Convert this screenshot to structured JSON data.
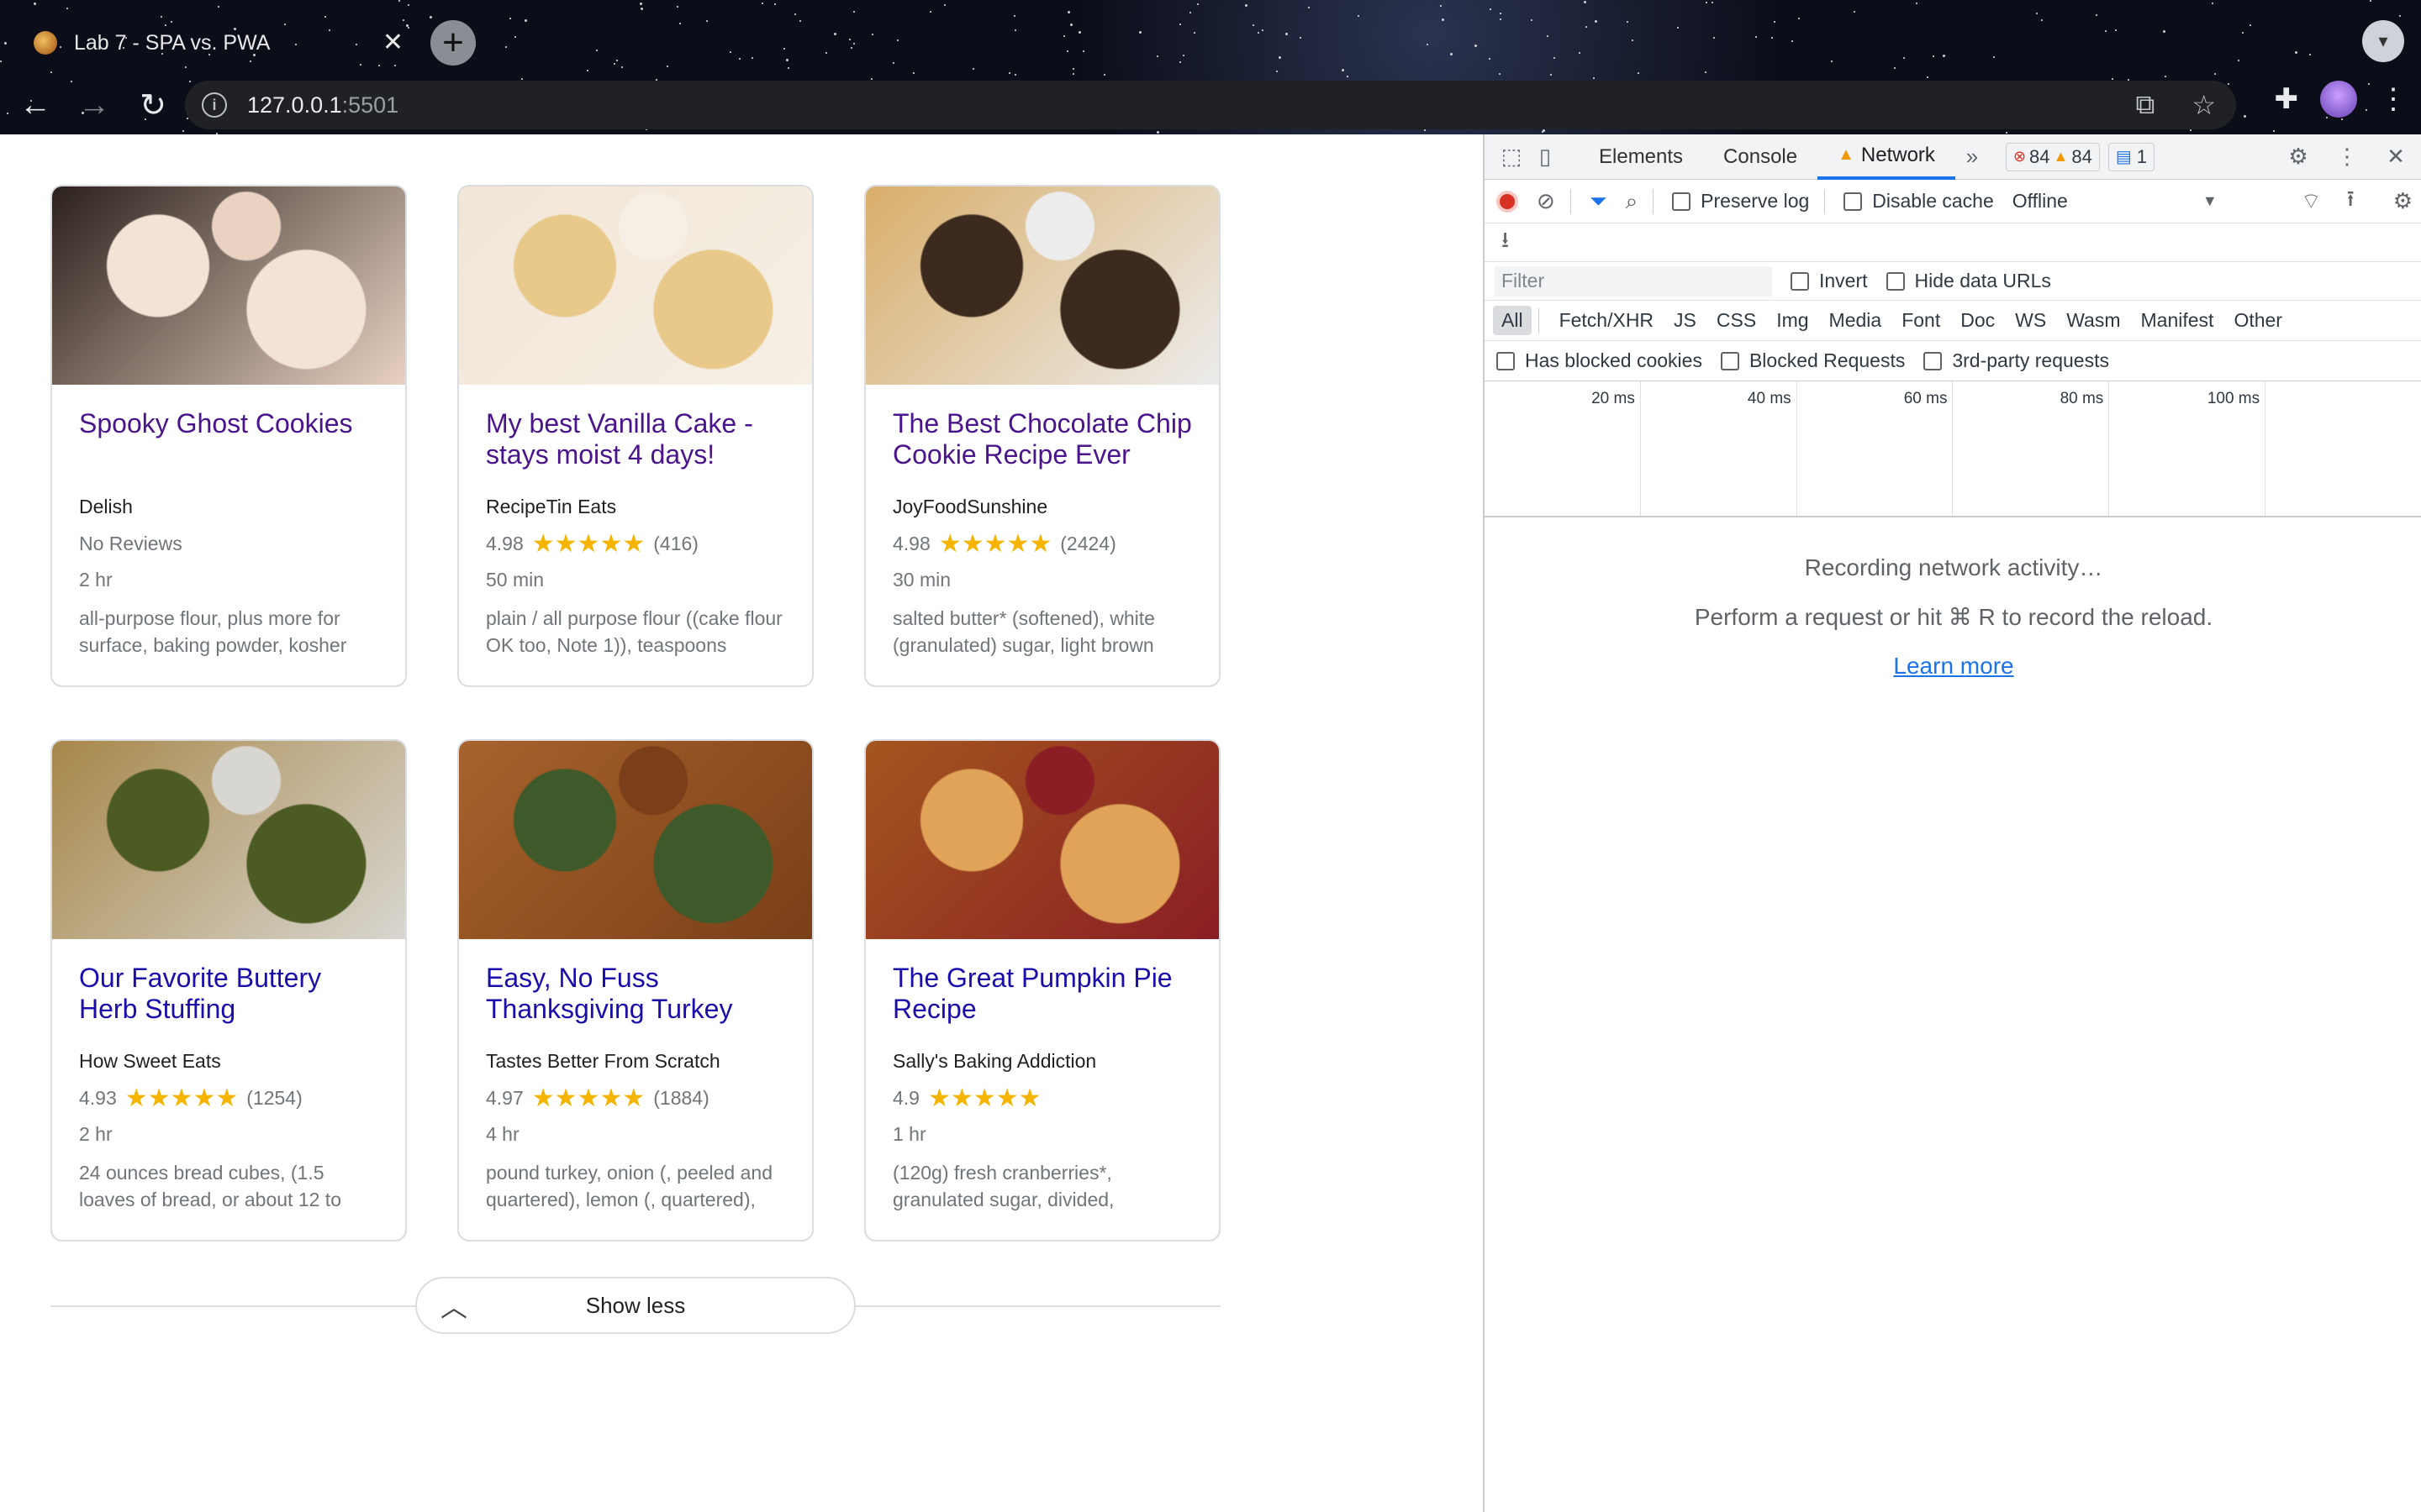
{
  "browser": {
    "tab_title": "Lab 7 - SPA vs. PWA",
    "url_host": "127.0.0.1",
    "url_port": ":5501"
  },
  "recipes": [
    {
      "title": "Spooky Ghost Cookies",
      "source": "Delish",
      "rating": "No Reviews",
      "stars": "",
      "count": "",
      "time": "2 hr",
      "ingredients": "all-purpose flour, plus more for surface, baking powder, kosher",
      "thumb_colors": [
        "#2a201c",
        "#f3e3d6",
        "#e9d2c2"
      ]
    },
    {
      "title": "My best Vanilla Cake - stays moist 4 days!",
      "source": "RecipeTin Eats",
      "rating": "4.98",
      "stars": "★★★★★",
      "count": "(416)",
      "time": "50 min",
      "ingredients": "plain / all purpose flour ((cake flour OK too, Note 1)), teaspoons",
      "thumb_colors": [
        "#f2e6d6",
        "#e8c98a",
        "#f6efe6"
      ]
    },
    {
      "title": "The Best Chocolate Chip Cookie Recipe Ever",
      "source": "JoyFoodSunshine",
      "rating": "4.98",
      "stars": "★★★★★",
      "count": "(2424)",
      "time": "30 min",
      "ingredients": "salted butter* (softened), white (granulated) sugar, light brown",
      "thumb_colors": [
        "#d9ae6a",
        "#3b2a1d",
        "#ececec"
      ]
    },
    {
      "title": "Our Favorite Buttery Herb Stuffing",
      "source": "How Sweet Eats",
      "rating": "4.93",
      "stars": "★★★★★",
      "count": "(1254)",
      "time": "2 hr",
      "ingredients": "24 ounces bread cubes, (1.5 loaves of bread, or about 12 to",
      "thumb_colors": [
        "#a7874a",
        "#4c5a24",
        "#d8d6d0"
      ]
    },
    {
      "title": "Easy, No Fuss Thanksgiving Turkey",
      "source": "Tastes Better From Scratch",
      "rating": "4.97",
      "stars": "★★★★★",
      "count": "(1884)",
      "time": "4 hr",
      "ingredients": "pound turkey, onion (, peeled and quartered), lemon (, quartered),",
      "thumb_colors": [
        "#a8622c",
        "#3e5a2a",
        "#7a3f18"
      ]
    },
    {
      "title": "The Great Pumpkin Pie Recipe",
      "source": "Sally's Baking Addiction",
      "rating": "4.9",
      "stars": "★★★★★",
      "count": "",
      "time": "1 hr",
      "ingredients": "(120g) fresh cranberries*, granulated sugar, divided,",
      "thumb_colors": [
        "#a4561e",
        "#e0a357",
        "#8a1e24"
      ]
    }
  ],
  "show_less_label": "Show less",
  "devtools": {
    "tabs": [
      "Elements",
      "Console",
      "Network"
    ],
    "active_tab": "Network",
    "error_count": "84",
    "warning_count": "84",
    "message_count": "1",
    "preserve_log": "Preserve log",
    "disable_cache": "Disable cache",
    "throttle": "Offline",
    "filter_placeholder": "Filter",
    "invert": "Invert",
    "hide_data_urls": "Hide data URLs",
    "types": [
      "All",
      "Fetch/XHR",
      "JS",
      "CSS",
      "Img",
      "Media",
      "Font",
      "Doc",
      "WS",
      "Wasm",
      "Manifest",
      "Other"
    ],
    "has_blocked_cookies": "Has blocked cookies",
    "blocked_requests": "Blocked Requests",
    "third_party": "3rd-party requests",
    "ticks": [
      "20 ms",
      "40 ms",
      "60 ms",
      "80 ms",
      "100 ms",
      ""
    ],
    "empty_line1": "Recording network activity…",
    "empty_line2": "Perform a request or hit ⌘ R to record the reload.",
    "learn_more": "Learn more"
  },
  "colors": {
    "visited_link": "#4a148c",
    "link": "#1a0dab",
    "star": "#f5b400",
    "accent": "#1a73e8"
  }
}
